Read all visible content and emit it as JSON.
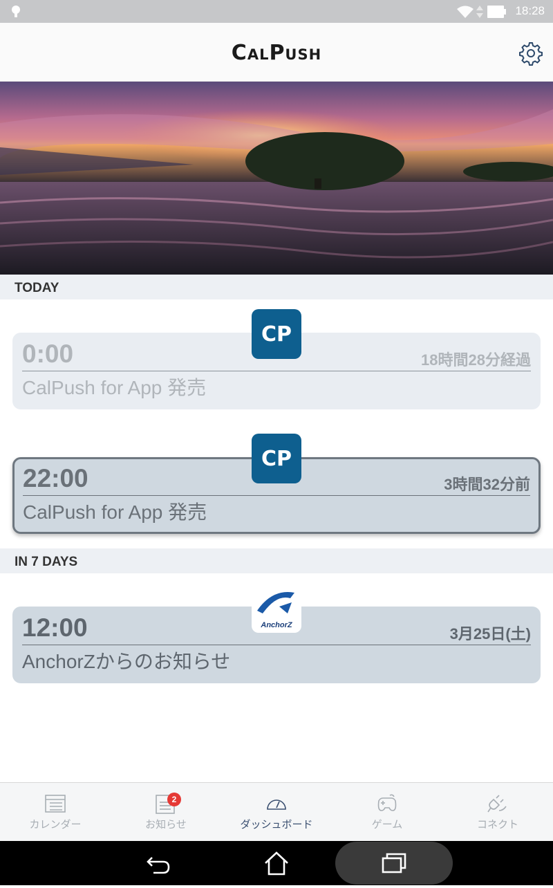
{
  "status_bar": {
    "time": "18:28",
    "icons": [
      "android-icon",
      "wifi-icon",
      "signal-icon",
      "battery-icon"
    ]
  },
  "header": {
    "title": "CalPush",
    "settings_icon": "gear-icon"
  },
  "sections": [
    {
      "label": "TODAY",
      "events": [
        {
          "time": "0:00",
          "relative": "18時間28分経過",
          "title": "CalPush for App 発売",
          "logo": "CP",
          "state": "past"
        },
        {
          "time": "22:00",
          "relative": "3時間32分前",
          "title": "CalPush for App 発売",
          "logo": "CP",
          "state": "selected"
        }
      ]
    },
    {
      "label": "IN 7 DAYS",
      "events": [
        {
          "time": "12:00",
          "relative": "3月25日(土)",
          "title": "AnchorZからのお知らせ",
          "logo": "AnchorZ",
          "state": "future"
        }
      ]
    }
  ],
  "bottom_nav": {
    "items": [
      {
        "label": "カレンダー",
        "icon": "calendar-icon",
        "active": false
      },
      {
        "label": "お知らせ",
        "icon": "news-icon",
        "active": false,
        "badge": "2"
      },
      {
        "label": "ダッシュボード",
        "icon": "dashboard-icon",
        "active": true
      },
      {
        "label": "ゲーム",
        "icon": "gamepad-icon",
        "active": false
      },
      {
        "label": "コネクト",
        "icon": "plug-icon",
        "active": false
      }
    ]
  },
  "system_nav": {
    "buttons": [
      "back-icon",
      "home-icon",
      "recents-icon"
    ]
  },
  "colors": {
    "accent": "#0e5f8f",
    "active_nav": "#3a4f70",
    "badge": "#e53935",
    "section_bg": "#edf0f4",
    "card_bg": "#cfd8e0"
  }
}
